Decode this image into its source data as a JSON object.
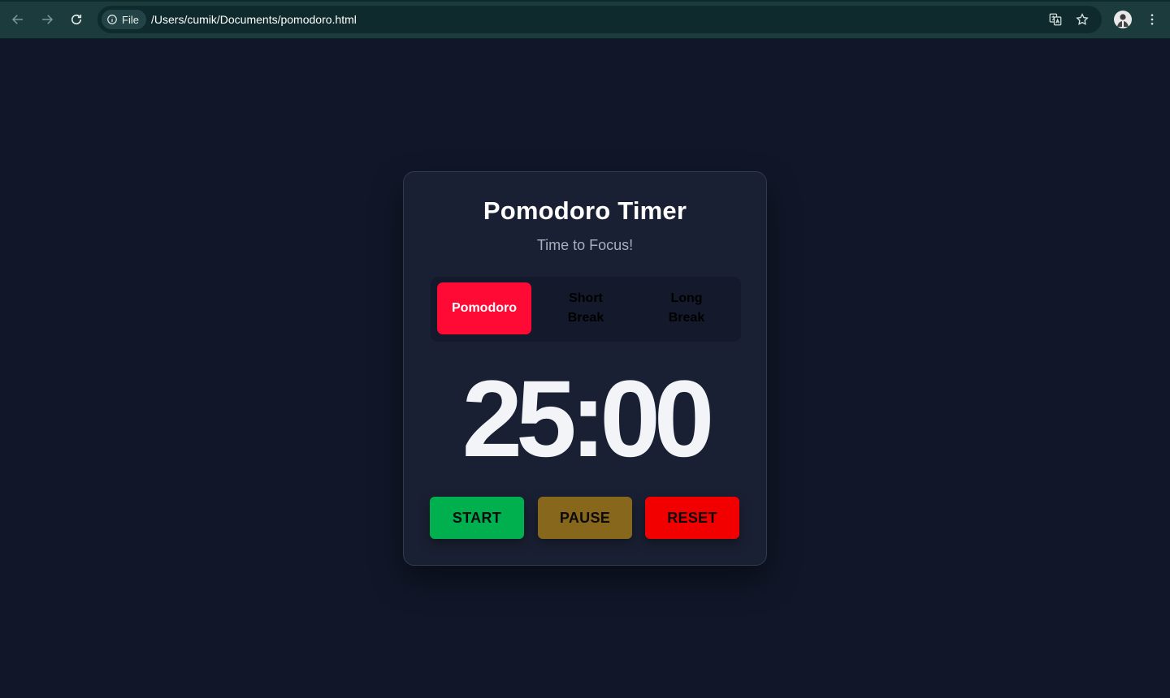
{
  "browser": {
    "scheme_chip": "File",
    "url": "/Users/cumik/Documents/pomodoro.html",
    "icons": [
      "back-arrow-icon",
      "forward-arrow-icon",
      "reload-icon",
      "info-icon",
      "translate-icon",
      "star-icon",
      "profile-avatar",
      "more-vert-icon"
    ]
  },
  "app": {
    "title": "Pomodoro Timer",
    "subtitle": "Time to Focus!",
    "modes": [
      {
        "label": "Pomodoro",
        "active": true
      },
      {
        "label": "Short Break",
        "active": false
      },
      {
        "label": "Long Break",
        "active": false
      }
    ],
    "time": "25:00",
    "controls": {
      "start": {
        "label": "START",
        "color": "#00b04f"
      },
      "pause": {
        "label": "PAUSE",
        "color": "#86671c"
      },
      "reset": {
        "label": "RESET",
        "color": "#f20000"
      }
    },
    "colors": {
      "background": "#111729",
      "card": "#1a2033",
      "mode_active": "#ff0a35"
    }
  }
}
